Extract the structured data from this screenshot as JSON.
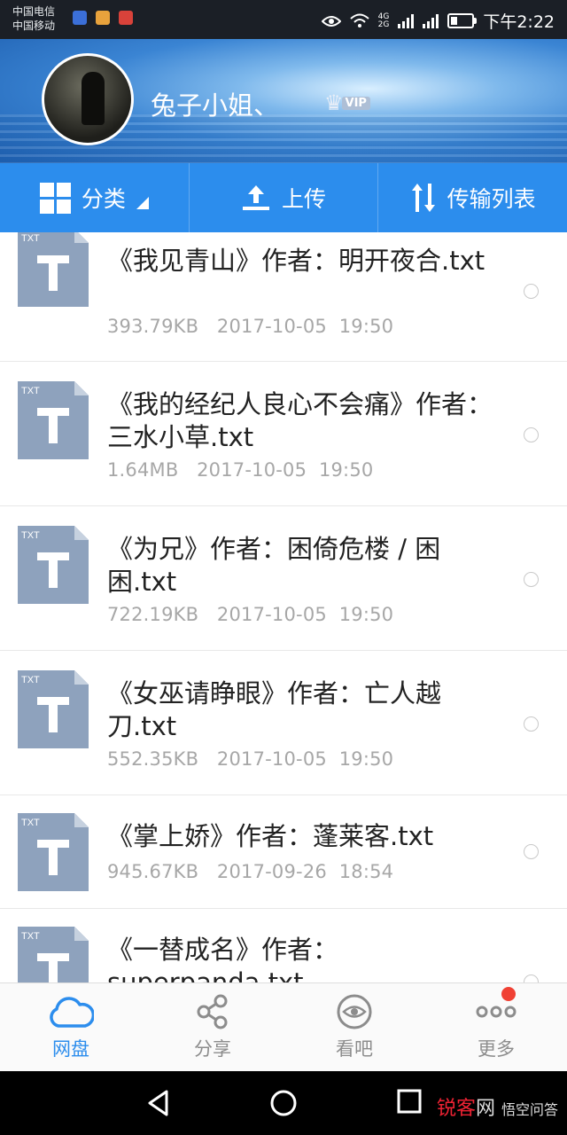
{
  "status_bar": {
    "carrier1": "中国电信",
    "carrier2": "中国移动",
    "net1": "4G",
    "net2": "2G",
    "time": "下午2:22"
  },
  "header": {
    "username": "兔子小姐、",
    "vip_label": "VIP"
  },
  "toolbar": {
    "category": "分类",
    "upload": "上传",
    "transfer": "传输列表"
  },
  "files": [
    {
      "type": "TXT",
      "name": "《我见青山》作者：明开夜合.txt",
      "size": "393.79KB",
      "date": "2017-10-05",
      "time": "19:50"
    },
    {
      "type": "TXT",
      "name": "《我的经纪人良心不会痛》作者：三水小草.txt",
      "size": "1.64MB",
      "date": "2017-10-05",
      "time": "19:50"
    },
    {
      "type": "TXT",
      "name": "《为兄》作者：困倚危楼 / 困困.txt",
      "size": "722.19KB",
      "date": "2017-10-05",
      "time": "19:50"
    },
    {
      "type": "TXT",
      "name": "《女巫请睁眼》作者：亡人越刀.txt",
      "size": "552.35KB",
      "date": "2017-10-05",
      "time": "19:50"
    },
    {
      "type": "TXT",
      "name": "《掌上娇》作者：蓬莱客.txt",
      "size": "945.67KB",
      "date": "2017-09-26",
      "time": "18:54"
    },
    {
      "type": "TXT",
      "name": "《一替成名》作者：superpanda.txt",
      "size": "",
      "date": "",
      "time": ""
    }
  ],
  "bottom_nav": {
    "disk": "网盘",
    "share": "分享",
    "watch": "看吧",
    "more": "更多"
  },
  "watermark": {
    "brand_red": "锐客",
    "brand_rest": "网",
    "sub": "悟空问答"
  },
  "colors": {
    "accent": "#2c8ded",
    "file_icon": "#8ea2bd",
    "badge": "#f04134"
  }
}
